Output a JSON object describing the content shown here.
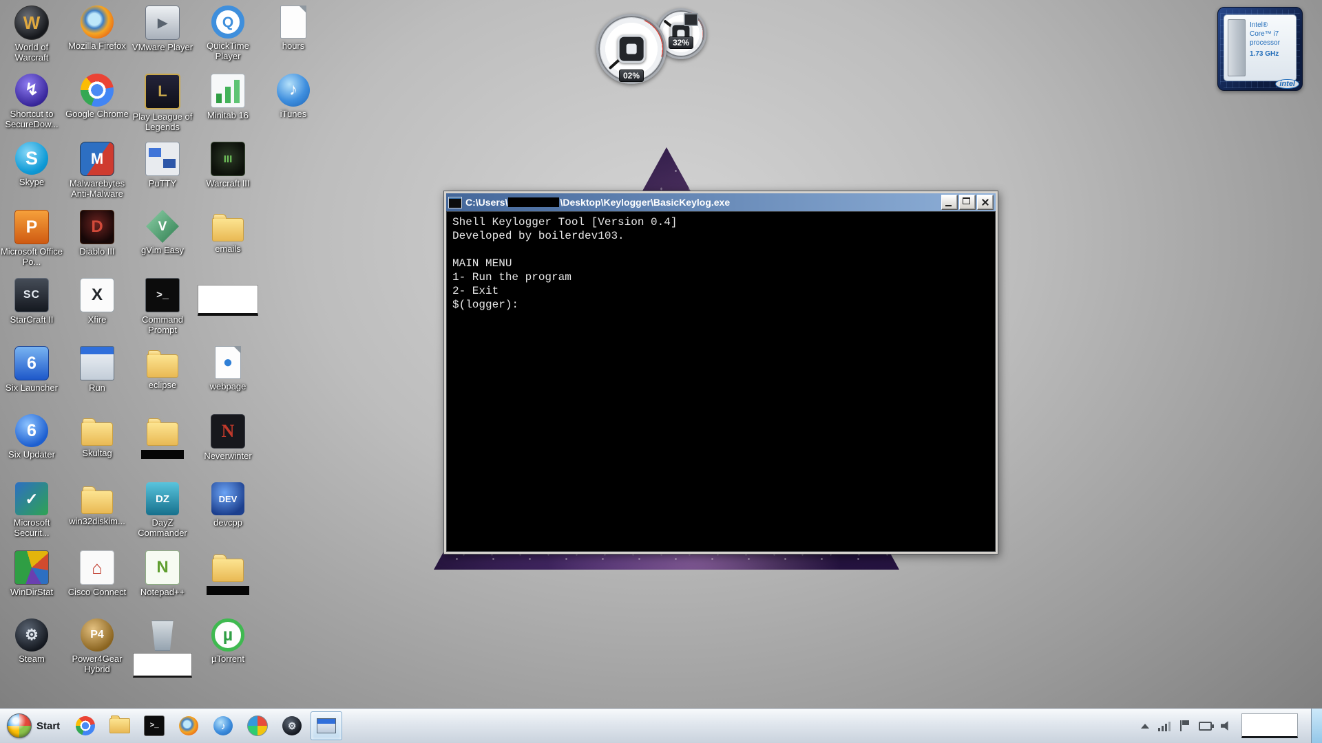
{
  "desktop": {
    "icons": [
      {
        "name": "world-of-warcraft",
        "label": "World of Warcraft",
        "icon": "wow",
        "glyph": "W",
        "col": 0,
        "row": 0
      },
      {
        "name": "shortcut-securedow",
        "label": "Shortcut to SecureDow...",
        "icon": "securedow",
        "glyph": "↯",
        "col": 0,
        "row": 1
      },
      {
        "name": "skype",
        "label": "Skype",
        "icon": "skype",
        "glyph": "S",
        "col": 0,
        "row": 2
      },
      {
        "name": "microsoft-office-po",
        "label": "Microsoft Office Po...",
        "icon": "officepo",
        "glyph": "P",
        "col": 0,
        "row": 3
      },
      {
        "name": "starcraft-ii",
        "label": "StarCraft II",
        "icon": "starcraft2",
        "glyph": "SC",
        "col": 0,
        "row": 4
      },
      {
        "name": "six-launcher",
        "label": "Six Launcher",
        "icon": "sixlauncher",
        "glyph": "6",
        "col": 0,
        "row": 5
      },
      {
        "name": "six-updater",
        "label": "Six Updater",
        "icon": "sixupdater",
        "glyph": "6",
        "col": 0,
        "row": 6
      },
      {
        "name": "microsoft-security",
        "label": "Microsoft Securit...",
        "icon": "mssecurity",
        "glyph": "✓",
        "col": 0,
        "row": 7
      },
      {
        "name": "windirstat",
        "label": "WinDirStat",
        "icon": "windirstat",
        "glyph": "",
        "col": 0,
        "row": 8
      },
      {
        "name": "steam",
        "label": "Steam",
        "icon": "steam",
        "glyph": "⚙",
        "col": 0,
        "row": 9
      },
      {
        "name": "mozilla-firefox",
        "label": "Mozilla Firefox",
        "icon": "firefox",
        "glyph": "",
        "col": 1,
        "row": 0
      },
      {
        "name": "google-chrome",
        "label": "Google Chrome",
        "icon": "chrome",
        "glyph": "",
        "col": 1,
        "row": 1
      },
      {
        "name": "malwarebytes",
        "label": "Malwarebytes Anti-Malware",
        "icon": "malwarebytes",
        "glyph": "M",
        "col": 1,
        "row": 2
      },
      {
        "name": "diablo-iii",
        "label": "Diablo III",
        "icon": "diablo3",
        "glyph": "D",
        "col": 1,
        "row": 3
      },
      {
        "name": "xfire",
        "label": "Xfire",
        "icon": "xfire",
        "glyph": "X",
        "col": 1,
        "row": 4
      },
      {
        "name": "run",
        "label": "Run",
        "icon": "run",
        "glyph": "",
        "col": 1,
        "row": 5
      },
      {
        "name": "skultag",
        "label": "Skultag",
        "icon": "folder",
        "glyph": "",
        "col": 1,
        "row": 6
      },
      {
        "name": "win32diskim",
        "label": "win32diskim...",
        "icon": "folder",
        "glyph": "",
        "col": 1,
        "row": 7
      },
      {
        "name": "cisco-connect",
        "label": "Cisco Connect",
        "icon": "cisco",
        "glyph": "⌂",
        "col": 1,
        "row": 8
      },
      {
        "name": "power4gear-hybrid",
        "label": "Power4Gear Hybrid",
        "icon": "power4gear",
        "glyph": "P4",
        "col": 1,
        "row": 9
      },
      {
        "name": "vmware-player",
        "label": "VMware Player",
        "icon": "vmware",
        "glyph": "▶",
        "col": 2,
        "row": 0
      },
      {
        "name": "play-league-of-legends",
        "label": "Play League of Legends",
        "icon": "league",
        "glyph": "L",
        "col": 2,
        "row": 1
      },
      {
        "name": "putty",
        "label": "PuTTY",
        "icon": "putty",
        "glyph": "",
        "col": 2,
        "row": 2
      },
      {
        "name": "gvim-easy",
        "label": "gVim Easy",
        "icon": "gvim",
        "glyph": "V",
        "col": 2,
        "row": 3
      },
      {
        "name": "command-prompt",
        "label": "Command Prompt",
        "icon": "cmd",
        "glyph": ">_",
        "col": 2,
        "row": 4
      },
      {
        "name": "eclipse",
        "label": "eclipse",
        "icon": "folder",
        "glyph": "",
        "col": 2,
        "row": 5
      },
      {
        "name": "redacted-folder-1",
        "label": "",
        "icon": "folder",
        "glyph": "",
        "redact": "black",
        "col": 2,
        "row": 6
      },
      {
        "name": "dayz-commander",
        "label": "DayZ Commander",
        "icon": "dayz",
        "glyph": "DZ",
        "col": 2,
        "row": 7
      },
      {
        "name": "notepad-plus-plus",
        "label": "Notepad++",
        "icon": "notepadpp",
        "glyph": "N",
        "col": 2,
        "row": 8
      },
      {
        "name": "recycle-bin",
        "label": "",
        "icon": "bin",
        "glyph": "",
        "redact": "white",
        "col": 2,
        "row": 9
      },
      {
        "name": "quicktime-player",
        "label": "QuickTime Player",
        "icon": "quicktime",
        "glyph": "Q",
        "col": 3,
        "row": 0
      },
      {
        "name": "minitab-16",
        "label": "Minitab 16",
        "icon": "minitab",
        "glyph": "",
        "col": 3,
        "row": 1
      },
      {
        "name": "warcraft-iii",
        "label": "Warcraft III",
        "icon": "warcraft3",
        "glyph": "III",
        "col": 3,
        "row": 2
      },
      {
        "name": "emails",
        "label": "emails",
        "icon": "folder",
        "glyph": "",
        "col": 3,
        "row": 3
      },
      {
        "name": "redacted-item",
        "label": "",
        "icon": "whitebox",
        "glyph": "",
        "col": 3,
        "row": 4
      },
      {
        "name": "webpage",
        "label": "webpage",
        "icon": "doc i-webpage",
        "glyph": "●",
        "col": 3,
        "row": 5
      },
      {
        "name": "neverwinter",
        "label": "Neverwinter",
        "icon": "neverwinter",
        "glyph": "N",
        "col": 3,
        "row": 6
      },
      {
        "name": "devcpp",
        "label": "devcpp",
        "icon": "devcpp",
        "glyph": "DEV",
        "col": 3,
        "row": 7
      },
      {
        "name": "redacted-folder-2",
        "label": "",
        "icon": "folder",
        "glyph": "",
        "redact": "black",
        "col": 3,
        "row": 8
      },
      {
        "name": "utorrent",
        "label": "µTorrent",
        "icon": "utorrent",
        "glyph": "µ",
        "col": 3,
        "row": 9
      },
      {
        "name": "hours",
        "label": "hours",
        "icon": "doc",
        "glyph": "",
        "col": 4,
        "row": 0
      },
      {
        "name": "itunes",
        "label": "iTunes",
        "icon": "itunes",
        "glyph": "♪",
        "col": 4,
        "row": 1
      }
    ]
  },
  "gadgets": {
    "cpu_gauge": {
      "percent": "02%"
    },
    "ram_gauge": {
      "percent": "32%"
    },
    "intel_widget": {
      "line1": "Intel®",
      "line2": "Core™ i7",
      "line3": "processor",
      "line4": "1.73 GHz",
      "logo": "intel"
    }
  },
  "console": {
    "title_prefix": "C:\\Users\\",
    "title_suffix": "\\Desktop\\Keylogger\\BasicKeylog.exe",
    "lines": [
      "Shell Keylogger Tool [Version 0.4]",
      "Developed by boilerdev103.",
      "",
      "MAIN MENU",
      "1- Run the program",
      "2- Exit",
      "$(logger):"
    ]
  },
  "taskbar": {
    "start_label": "Start",
    "items": [
      {
        "name": "chrome",
        "icon": "t-chrome",
        "glyph": ""
      },
      {
        "name": "explorer",
        "icon": "t-folder",
        "glyph": ""
      },
      {
        "name": "command-prompt",
        "icon": "t-cmd",
        "glyph": ">_"
      },
      {
        "name": "firefox",
        "icon": "t-firefox",
        "glyph": ""
      },
      {
        "name": "itunes",
        "icon": "t-itunes",
        "glyph": "♪"
      },
      {
        "name": "paint",
        "icon": "t-paint",
        "glyph": ""
      },
      {
        "name": "steam",
        "icon": "t-steam",
        "glyph": "⚙"
      },
      {
        "name": "keylogger-console",
        "icon": "t-window",
        "glyph": "",
        "active": true
      }
    ]
  }
}
